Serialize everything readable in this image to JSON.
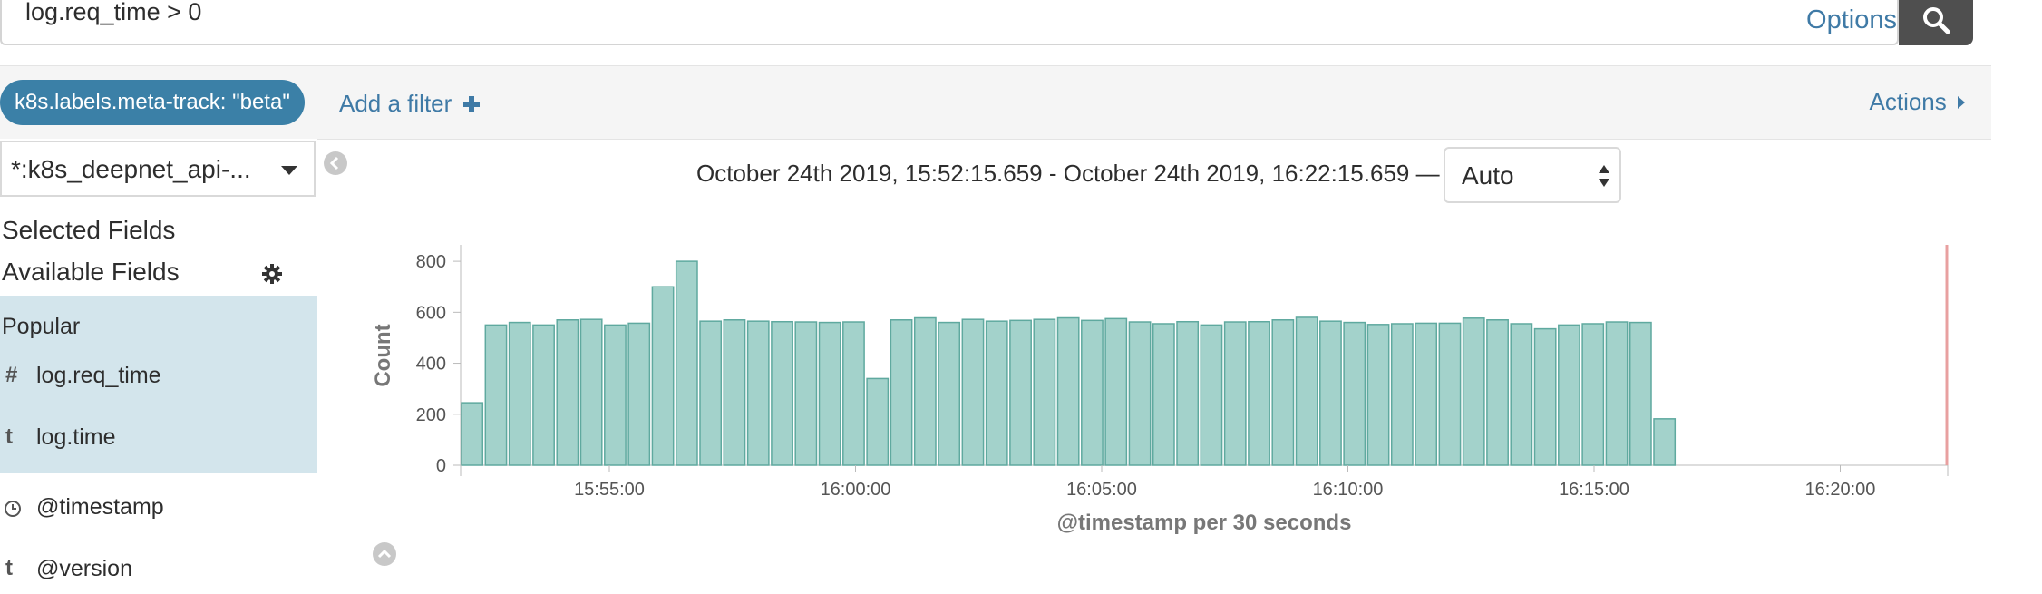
{
  "query": {
    "text": "log.req_time > 0",
    "options_label": "Options"
  },
  "filters": {
    "pill_label": "k8s.labels.meta-track: \"beta\"",
    "add_label": "Add a filter",
    "actions_label": "Actions"
  },
  "sidebar": {
    "index_pattern": "*:k8s_deepnet_api-...",
    "selected_fields": "Selected Fields",
    "available_fields": "Available Fields",
    "popular_label": "Popular",
    "popular_fields": [
      {
        "type": "#",
        "name": "log.req_time"
      },
      {
        "type": "t",
        "name": "log.time"
      }
    ],
    "other_fields": [
      {
        "type": "clock-icon",
        "name": "@timestamp"
      },
      {
        "type": "t",
        "name": "@version"
      }
    ]
  },
  "main": {
    "time_range": "October 24th 2019, 15:52:15.659 - October 24th 2019, 16:22:15.659 —",
    "interval": "Auto"
  },
  "chart_data": {
    "type": "bar",
    "xlabel": "@timestamp per 30 seconds",
    "ylabel": "Count",
    "ylim": [
      0,
      900
    ],
    "yticks": [
      0,
      200,
      400,
      600,
      800
    ],
    "xticks": [
      "15:55:00",
      "16:00:00",
      "16:05:00",
      "16:10:00",
      "16:15:00",
      "16:20:00"
    ],
    "bar_color": "#a3d2cb",
    "bar_border": "#5fa99f",
    "values": [
      245,
      550,
      560,
      550,
      570,
      572,
      550,
      557,
      700,
      800,
      565,
      570,
      565,
      563,
      562,
      560,
      562,
      340,
      570,
      578,
      560,
      572,
      565,
      568,
      572,
      578,
      568,
      575,
      562,
      555,
      563,
      550,
      562,
      563,
      570,
      580,
      565,
      560,
      552,
      555,
      557,
      557,
      577,
      570,
      555,
      535,
      550,
      555,
      562,
      560,
      182
    ]
  },
  "colors": {
    "accent": "#3f7aa6",
    "pill": "#3b80a7",
    "popular_bg": "#d3e5ec",
    "end_marker": "#e8a0a0"
  }
}
